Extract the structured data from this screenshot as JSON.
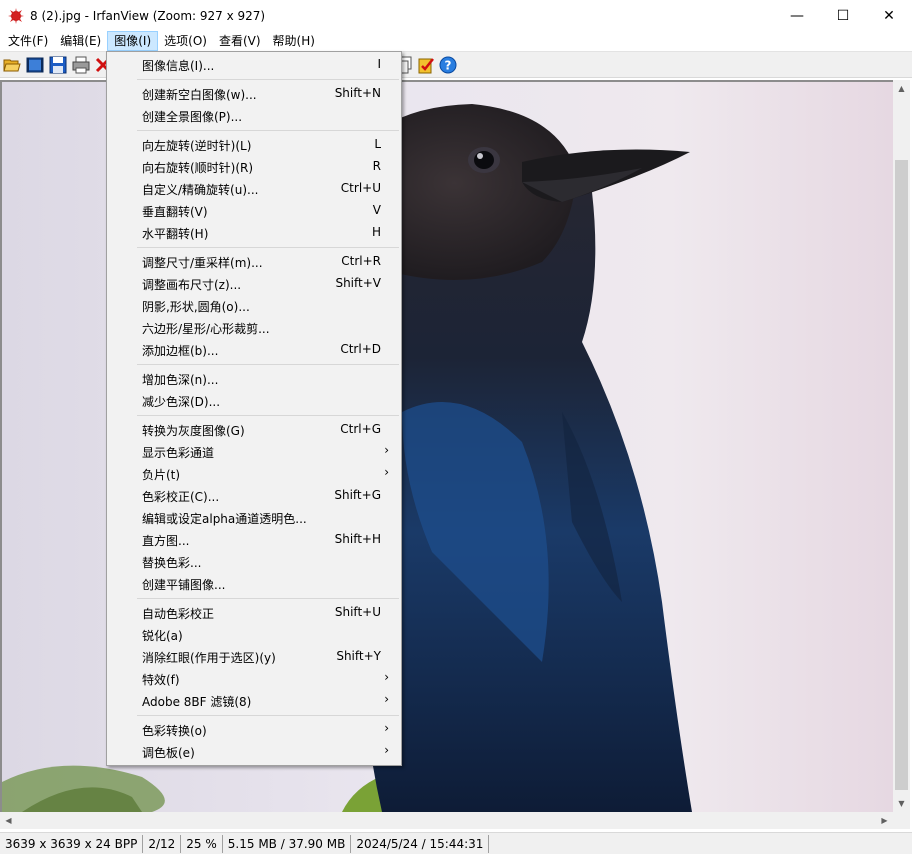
{
  "window": {
    "title": "8 (2).jpg - IrfanView (Zoom: 927 x 927)",
    "minimize": "—",
    "maximize": "☐",
    "close": "✕"
  },
  "menubar": {
    "items": [
      "文件(F)",
      "编辑(E)",
      "图像(I)",
      "选项(O)",
      "查看(V)",
      "帮助(H)"
    ],
    "active_index": 2
  },
  "toolbar": {
    "icons": [
      "open-folder-icon",
      "thumbnails-icon",
      "save-icon",
      "print-icon",
      "delete-icon",
      "copy-icon",
      "checklist-icon",
      "help-icon"
    ]
  },
  "image_menu": {
    "groups": [
      [
        {
          "label": "图像信息(I)...",
          "shortcut": "I"
        }
      ],
      [
        {
          "label": "创建新空白图像(w)...",
          "shortcut": "Shift+N"
        },
        {
          "label": "创建全景图像(P)...",
          "shortcut": ""
        }
      ],
      [
        {
          "label": "向左旋转(逆时针)(L)",
          "shortcut": "L"
        },
        {
          "label": "向右旋转(顺时针)(R)",
          "shortcut": "R"
        },
        {
          "label": "自定义/精确旋转(u)...",
          "shortcut": "Ctrl+U"
        },
        {
          "label": "垂直翻转(V)",
          "shortcut": "V"
        },
        {
          "label": "水平翻转(H)",
          "shortcut": "H"
        }
      ],
      [
        {
          "label": "调整尺寸/重采样(m)...",
          "shortcut": "Ctrl+R"
        },
        {
          "label": "调整画布尺寸(z)...",
          "shortcut": "Shift+V"
        },
        {
          "label": "阴影,形状,圆角(o)...",
          "shortcut": ""
        },
        {
          "label": "六边形/星形/心形裁剪...",
          "shortcut": ""
        },
        {
          "label": "添加边框(b)...",
          "shortcut": "Ctrl+D"
        }
      ],
      [
        {
          "label": "增加色深(n)...",
          "shortcut": ""
        },
        {
          "label": "减少色深(D)...",
          "shortcut": ""
        }
      ],
      [
        {
          "label": "转换为灰度图像(G)",
          "shortcut": "Ctrl+G"
        },
        {
          "label": "显示色彩通道",
          "shortcut": "",
          "submenu": true
        },
        {
          "label": "负片(t)",
          "shortcut": "",
          "submenu": true
        },
        {
          "label": "色彩校正(C)...",
          "shortcut": "Shift+G"
        },
        {
          "label": "编辑或设定alpha通道透明色...",
          "shortcut": ""
        },
        {
          "label": "直方图...",
          "shortcut": "Shift+H"
        },
        {
          "label": "替换色彩...",
          "shortcut": ""
        },
        {
          "label": "创建平铺图像...",
          "shortcut": ""
        }
      ],
      [
        {
          "label": "自动色彩校正",
          "shortcut": "Shift+U"
        },
        {
          "label": "锐化(a)",
          "shortcut": ""
        },
        {
          "label": "消除红眼(作用于选区)(y)",
          "shortcut": "Shift+Y"
        },
        {
          "label": "特效(f)",
          "shortcut": "",
          "submenu": true
        },
        {
          "label": "Adobe 8BF 滤镜(8)",
          "shortcut": "",
          "submenu": true
        }
      ],
      [
        {
          "label": "色彩转换(o)",
          "shortcut": "",
          "submenu": true
        },
        {
          "label": "调色板(e)",
          "shortcut": "",
          "submenu": true
        }
      ]
    ]
  },
  "statusbar": {
    "dimensions": "3639 x 3639 x 24 BPP",
    "index": "2/12",
    "zoom": "25 %",
    "size": "5.15 MB / 37.90 MB",
    "datetime": "2024/5/24 / 15:44:31"
  }
}
